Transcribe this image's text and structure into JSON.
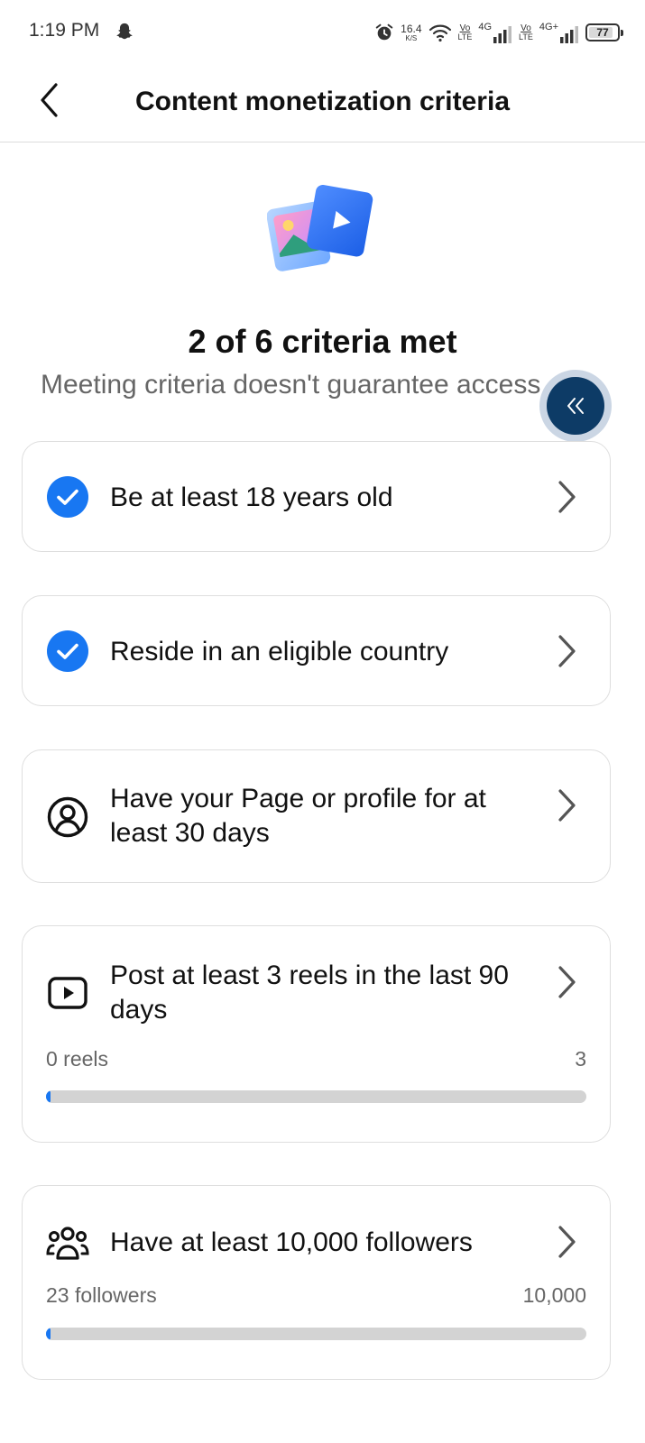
{
  "status_bar": {
    "time": "1:19 PM",
    "net_speed_value": "16.4",
    "net_speed_unit": "K/S",
    "sim1_volte_top": "Vo",
    "sim1_volte_bottom": "LTE",
    "sim1_network": "4G",
    "sim2_volte_top": "Vo",
    "sim2_volte_bottom": "LTE",
    "sim2_network": "4G+",
    "battery_level": "77",
    "icons": [
      "snapchat-ghost-icon",
      "alarm-icon",
      "wifi-icon",
      "signal-icon",
      "battery-icon"
    ]
  },
  "header": {
    "title": "Content monetization criteria",
    "back_icon": "back-arrow-icon"
  },
  "summary": {
    "title": "2 of 6 criteria met",
    "subtitle": "Meeting criteria doesn't guarantee access"
  },
  "floating_button": {
    "icon": "double-chevron-left-icon"
  },
  "criteria": [
    {
      "label": "Be at least 18 years old",
      "status": "met",
      "icon": "check-circle-icon"
    },
    {
      "label": "Reside in an eligible country",
      "status": "met",
      "icon": "check-circle-icon"
    },
    {
      "label": "Have your Page or profile for at least 30 days",
      "status": "not-met",
      "icon": "profile-circle-icon"
    },
    {
      "label": "Post at least 3 reels in the last 90 days",
      "status": "not-met",
      "icon": "reel-play-icon",
      "progress": {
        "current_label": "0 reels",
        "target_label": "3",
        "current": 0,
        "target": 3
      }
    },
    {
      "label": "Have at least 10,000 followers",
      "status": "not-met",
      "icon": "followers-icon",
      "progress": {
        "current_label": "23 followers",
        "target_label": "10,000",
        "current": 23,
        "target": 10000
      }
    }
  ],
  "colors": {
    "accent": "#1877f2",
    "bubble": "#0d3b66",
    "progress_track": "#d3d3d3",
    "card_border": "#dedede"
  }
}
